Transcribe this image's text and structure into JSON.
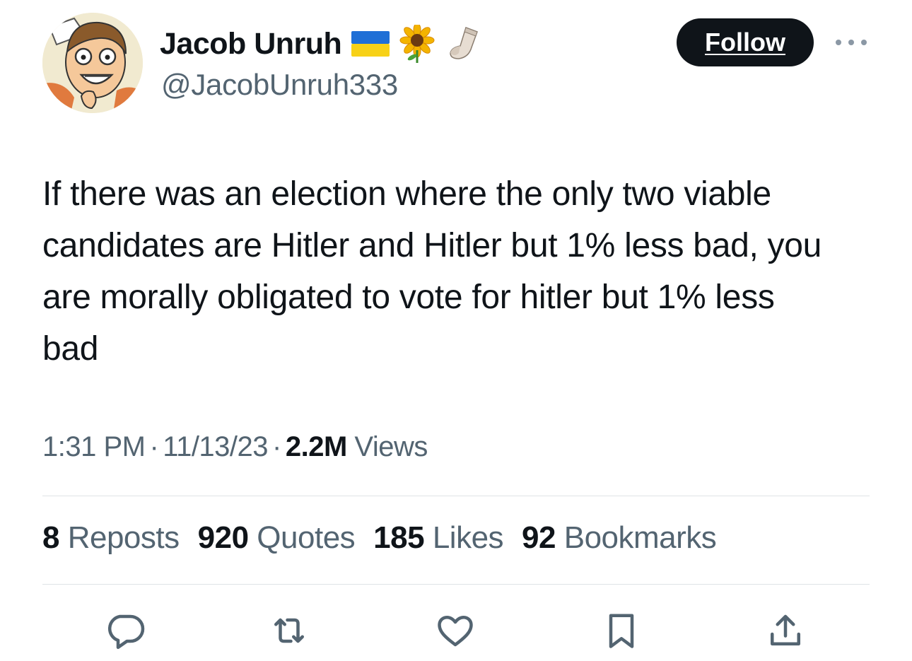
{
  "author": {
    "display_name": "Jacob Unruh",
    "handle": "@JacobUnruh333",
    "name_emojis": [
      "ukraine-flag-icon",
      "sunflower-icon",
      "sock-icon"
    ]
  },
  "follow_label": "Follow",
  "tweet": {
    "text": "If there was an election where the only two viable candidates are Hitler and Hitler but 1% less bad, you are morally obligated to vote for hitler but 1% less bad"
  },
  "meta": {
    "time": "1:31 PM",
    "separator": "·",
    "date": "11/13/23",
    "views_count": "2.2M",
    "views_label": "Views"
  },
  "stats": {
    "reposts_count": "8",
    "reposts_label": "Reposts",
    "quotes_count": "920",
    "quotes_label": "Quotes",
    "likes_count": "185",
    "likes_label": "Likes",
    "bookmarks_count": "92",
    "bookmarks_label": "Bookmarks"
  },
  "actions": [
    "reply-icon",
    "repost-icon",
    "like-icon",
    "bookmark-icon",
    "share-icon"
  ],
  "colors": {
    "text_primary": "#0f1419",
    "text_secondary": "#536471",
    "divider": "#dfe3e6",
    "button_bg": "#0f1419",
    "button_text": "#ffffff"
  }
}
